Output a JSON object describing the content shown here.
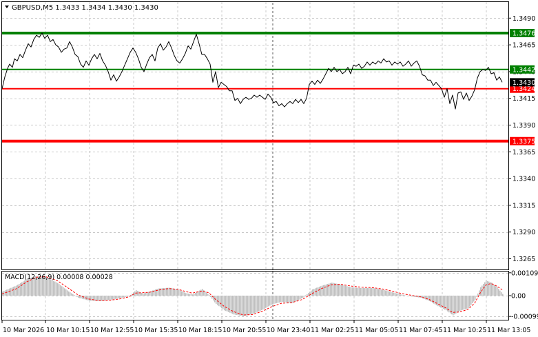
{
  "chart_data": [
    {
      "type": "line",
      "title": "GBPUSD,M5  1.3433 1.3434 1.3430 1.3430",
      "symbol": "GBPUSD,M5",
      "ohlc_label": "1.3433 1.3434 1.3430 1.3430",
      "ylim": [
        1.3255,
        1.3505
      ],
      "yticks": [
        "1.3490",
        "1.3465",
        "1.3440",
        "1.3415",
        "1.3390",
        "1.3365",
        "1.3340",
        "1.3315",
        "1.3290",
        "1.3265"
      ],
      "ytick_values": [
        1.349,
        1.3465,
        1.344,
        1.3415,
        1.339,
        1.3365,
        1.334,
        1.3315,
        1.329,
        1.3265
      ],
      "xlabels": [
        "10 Mar 2026",
        "10 Mar 10:15",
        "10 Mar 12:55",
        "10 Mar 15:35",
        "10 Mar 18:15",
        "10 Mar 20:55",
        "10 Mar 23:40",
        "11 Mar 02:25",
        "11 Mar 05:05",
        "11 Mar 07:45",
        "11 Mar 10:25",
        "11 Mar 13:05"
      ],
      "grid": true,
      "levels": [
        {
          "label": "1.3476",
          "value": 1.3476,
          "color": "#008000",
          "style": "thick"
        },
        {
          "label": "1.3442",
          "value": 1.3442,
          "color": "#008000",
          "style": "thin"
        },
        {
          "label": "1.3424",
          "value": 1.3424,
          "color": "#ff0000",
          "style": "thin"
        },
        {
          "label": "1.3375",
          "value": 1.3375,
          "color": "#ff0000",
          "style": "thick"
        }
      ],
      "current_price": {
        "label": "1.3430",
        "value": 1.343
      },
      "price_series": [
        [
          0,
          1.3424
        ],
        [
          4,
          1.3435
        ],
        [
          8,
          1.3443
        ],
        [
          11,
          1.3447
        ],
        [
          15,
          1.3444
        ],
        [
          18,
          1.3452
        ],
        [
          22,
          1.345
        ],
        [
          26,
          1.3456
        ],
        [
          30,
          1.3453
        ],
        [
          34,
          1.346
        ],
        [
          38,
          1.3466
        ],
        [
          42,
          1.3463
        ],
        [
          46,
          1.347
        ],
        [
          50,
          1.3474
        ],
        [
          54,
          1.3472
        ],
        [
          58,
          1.3476
        ],
        [
          62,
          1.3471
        ],
        [
          66,
          1.3474
        ],
        [
          70,
          1.3468
        ],
        [
          74,
          1.347
        ],
        [
          78,
          1.3465
        ],
        [
          82,
          1.3463
        ],
        [
          86,
          1.3458
        ],
        [
          90,
          1.3461
        ],
        [
          94,
          1.3462
        ],
        [
          98,
          1.3468
        ],
        [
          102,
          1.3463
        ],
        [
          106,
          1.3456
        ],
        [
          110,
          1.3454
        ],
        [
          114,
          1.3447
        ],
        [
          118,
          1.3444
        ],
        [
          122,
          1.345
        ],
        [
          126,
          1.3446
        ],
        [
          130,
          1.3452
        ],
        [
          134,
          1.3456
        ],
        [
          138,
          1.3452
        ],
        [
          142,
          1.3457
        ],
        [
          146,
          1.345
        ],
        [
          150,
          1.3446
        ],
        [
          154,
          1.344
        ],
        [
          158,
          1.3432
        ],
        [
          162,
          1.3437
        ],
        [
          166,
          1.3431
        ],
        [
          170,
          1.3435
        ],
        [
          174,
          1.344
        ],
        [
          178,
          1.3446
        ],
        [
          182,
          1.3452
        ],
        [
          186,
          1.3458
        ],
        [
          190,
          1.3462
        ],
        [
          194,
          1.3458
        ],
        [
          198,
          1.3452
        ],
        [
          202,
          1.3444
        ],
        [
          206,
          1.344
        ],
        [
          210,
          1.3447
        ],
        [
          214,
          1.3453
        ],
        [
          218,
          1.3456
        ],
        [
          222,
          1.345
        ],
        [
          226,
          1.3462
        ],
        [
          230,
          1.3466
        ],
        [
          234,
          1.346
        ],
        [
          238,
          1.3463
        ],
        [
          242,
          1.3468
        ],
        [
          246,
          1.3462
        ],
        [
          250,
          1.3455
        ],
        [
          254,
          1.345
        ],
        [
          258,
          1.3448
        ],
        [
          262,
          1.3452
        ],
        [
          266,
          1.3457
        ],
        [
          270,
          1.3464
        ],
        [
          274,
          1.3461
        ],
        [
          278,
          1.3468
        ],
        [
          282,
          1.3475
        ],
        [
          286,
          1.3466
        ],
        [
          290,
          1.3456
        ],
        [
          294,
          1.3456
        ],
        [
          298,
          1.3452
        ],
        [
          302,
          1.3447
        ],
        [
          306,
          1.343
        ],
        [
          310,
          1.344
        ],
        [
          314,
          1.3425
        ],
        [
          318,
          1.343
        ],
        [
          322,
          1.3428
        ],
        [
          326,
          1.3426
        ],
        [
          330,
          1.3422
        ],
        [
          334,
          1.3422
        ],
        [
          338,
          1.3413
        ],
        [
          342,
          1.3415
        ],
        [
          346,
          1.341
        ],
        [
          350,
          1.3414
        ],
        [
          354,
          1.3416
        ],
        [
          358,
          1.3414
        ],
        [
          362,
          1.3415
        ],
        [
          366,
          1.3418
        ],
        [
          370,
          1.3416
        ],
        [
          374,
          1.3418
        ],
        [
          378,
          1.3416
        ],
        [
          382,
          1.3414
        ],
        [
          386,
          1.3419
        ],
        [
          390,
          1.3416
        ],
        [
          394,
          1.3411
        ],
        [
          398,
          1.3412
        ],
        [
          402,
          1.3408
        ],
        [
          406,
          1.341
        ],
        [
          410,
          1.3407
        ],
        [
          414,
          1.341
        ],
        [
          418,
          1.3412
        ],
        [
          422,
          1.341
        ],
        [
          426,
          1.3414
        ],
        [
          430,
          1.3411
        ],
        [
          434,
          1.3414
        ],
        [
          438,
          1.341
        ],
        [
          442,
          1.3415
        ],
        [
          446,
          1.3428
        ],
        [
          450,
          1.3431
        ],
        [
          454,
          1.3428
        ],
        [
          458,
          1.3432
        ],
        [
          462,
          1.3429
        ],
        [
          466,
          1.3433
        ],
        [
          470,
          1.3438
        ],
        [
          474,
          1.3443
        ],
        [
          478,
          1.344
        ],
        [
          482,
          1.3444
        ],
        [
          486,
          1.344
        ],
        [
          490,
          1.3442
        ],
        [
          494,
          1.3438
        ],
        [
          498,
          1.344
        ],
        [
          502,
          1.3444
        ],
        [
          506,
          1.3438
        ],
        [
          510,
          1.3446
        ],
        [
          514,
          1.3445
        ],
        [
          518,
          1.3447
        ],
        [
          522,
          1.3443
        ],
        [
          526,
          1.3445
        ],
        [
          530,
          1.3449
        ],
        [
          534,
          1.3446
        ],
        [
          538,
          1.3449
        ],
        [
          542,
          1.3447
        ],
        [
          546,
          1.345
        ],
        [
          550,
          1.3448
        ],
        [
          554,
          1.3452
        ],
        [
          558,
          1.3449
        ],
        [
          562,
          1.345
        ],
        [
          566,
          1.3446
        ],
        [
          570,
          1.3449
        ],
        [
          574,
          1.3447
        ],
        [
          578,
          1.3449
        ],
        [
          582,
          1.3445
        ],
        [
          586,
          1.3447
        ],
        [
          590,
          1.345
        ],
        [
          594,
          1.3445
        ],
        [
          598,
          1.3448
        ],
        [
          602,
          1.345
        ],
        [
          606,
          1.3445
        ],
        [
          610,
          1.3437
        ],
        [
          614,
          1.3436
        ],
        [
          618,
          1.3432
        ],
        [
          622,
          1.3432
        ],
        [
          626,
          1.3427
        ],
        [
          630,
          1.343
        ],
        [
          634,
          1.3427
        ],
        [
          638,
          1.3424
        ],
        [
          642,
          1.3416
        ],
        [
          646,
          1.3424
        ],
        [
          650,
          1.341
        ],
        [
          654,
          1.3418
        ],
        [
          658,
          1.3405
        ],
        [
          662,
          1.342
        ],
        [
          666,
          1.3421
        ],
        [
          670,
          1.3414
        ],
        [
          674,
          1.342
        ],
        [
          678,
          1.3413
        ],
        [
          682,
          1.3417
        ],
        [
          686,
          1.3423
        ],
        [
          690,
          1.3434
        ],
        [
          694,
          1.344
        ],
        [
          698,
          1.3442
        ],
        [
          702,
          1.3441
        ],
        [
          706,
          1.3444
        ],
        [
          710,
          1.3438
        ],
        [
          714,
          1.3439
        ],
        [
          718,
          1.3432
        ],
        [
          722,
          1.3435
        ],
        [
          726,
          1.343
        ]
      ]
    },
    {
      "type": "area",
      "title": "MACD(12,26,9) 0.00008 0.00028",
      "indicator_label": "MACD(12,26,9) 0.00008 0.00028",
      "ylim": [
        -0.00115,
        0.00115
      ],
      "yticks": [
        "0.00109",
        "0.00",
        "-0.00099"
      ],
      "ytick_values": [
        0.00109,
        0.0,
        -0.00099
      ],
      "histogram_color": "#c0c0c0",
      "signal_color": "#ff0000",
      "histogram": [
        [
          0,
          0.0002
        ],
        [
          20,
          0.00048
        ],
        [
          36,
          0.0008
        ],
        [
          50,
          0.00094
        ],
        [
          64,
          0.00088
        ],
        [
          80,
          0.0006
        ],
        [
          96,
          0.0002
        ],
        [
          110,
          -0.0001
        ],
        [
          126,
          -0.00024
        ],
        [
          142,
          -0.00026
        ],
        [
          156,
          -0.0002
        ],
        [
          170,
          -0.00012
        ],
        [
          184,
          -2e-05
        ],
        [
          194,
          0.00026
        ],
        [
          204,
          0.0001
        ],
        [
          214,
          0.0002
        ],
        [
          226,
          0.00034
        ],
        [
          242,
          0.00038
        ],
        [
          256,
          0.00028
        ],
        [
          266,
          0.00012
        ],
        [
          276,
          6e-05
        ],
        [
          290,
          0.00032
        ],
        [
          300,
          2e-05
        ],
        [
          310,
          -0.0004
        ],
        [
          322,
          -0.0007
        ],
        [
          336,
          -0.0009
        ],
        [
          350,
          -0.00098
        ],
        [
          364,
          -0.00086
        ],
        [
          378,
          -0.00066
        ],
        [
          392,
          -0.0004
        ],
        [
          406,
          -0.0003
        ],
        [
          420,
          -0.00036
        ],
        [
          436,
          -0.0001
        ],
        [
          450,
          0.0003
        ],
        [
          464,
          0.00048
        ],
        [
          478,
          0.00062
        ],
        [
          492,
          0.00052
        ],
        [
          506,
          0.0004
        ],
        [
          522,
          0.00036
        ],
        [
          538,
          0.00036
        ],
        [
          552,
          0.00028
        ],
        [
          566,
          0.00016
        ],
        [
          580,
          4e-05
        ],
        [
          594,
          -4e-05
        ],
        [
          608,
          -0.0001
        ],
        [
          620,
          -0.00026
        ],
        [
          632,
          -0.0005
        ],
        [
          644,
          -0.0007
        ],
        [
          654,
          -0.00094
        ],
        [
          664,
          -0.00072
        ],
        [
          676,
          -0.0006
        ],
        [
          686,
          -0.0002
        ],
        [
          694,
          0.0004
        ],
        [
          702,
          0.00072
        ],
        [
          710,
          0.00062
        ],
        [
          718,
          0.0004
        ],
        [
          726,
          8e-05
        ]
      ],
      "signal": [
        [
          0,
          8e-05
        ],
        [
          20,
          0.00032
        ],
        [
          36,
          0.00066
        ],
        [
          50,
          0.00088
        ],
        [
          64,
          0.0009
        ],
        [
          80,
          0.00072
        ],
        [
          96,
          0.00036
        ],
        [
          110,
          4e-05
        ],
        [
          126,
          -0.00016
        ],
        [
          142,
          -0.00024
        ],
        [
          156,
          -0.00022
        ],
        [
          170,
          -0.00016
        ],
        [
          184,
          -6e-05
        ],
        [
          194,
          0.00012
        ],
        [
          204,
          0.00014
        ],
        [
          214,
          0.00016
        ],
        [
          226,
          0.00026
        ],
        [
          242,
          0.00034
        ],
        [
          256,
          0.0003
        ],
        [
          266,
          0.0002
        ],
        [
          276,
          0.00012
        ],
        [
          290,
          0.00022
        ],
        [
          300,
          0.00014
        ],
        [
          310,
          -0.00018
        ],
        [
          322,
          -0.0005
        ],
        [
          336,
          -0.00076
        ],
        [
          350,
          -0.00092
        ],
        [
          364,
          -0.0009
        ],
        [
          378,
          -0.00074
        ],
        [
          392,
          -0.00052
        ],
        [
          406,
          -0.00036
        ],
        [
          420,
          -0.00034
        ],
        [
          436,
          -0.00018
        ],
        [
          450,
          0.0001
        ],
        [
          464,
          0.00034
        ],
        [
          478,
          0.00052
        ],
        [
          492,
          0.00054
        ],
        [
          506,
          0.00046
        ],
        [
          522,
          0.0004
        ],
        [
          538,
          0.00038
        ],
        [
          552,
          0.00032
        ],
        [
          566,
          0.00022
        ],
        [
          580,
          0.0001
        ],
        [
          594,
          2e-05
        ],
        [
          608,
          -6e-05
        ],
        [
          620,
          -0.00018
        ],
        [
          632,
          -0.00038
        ],
        [
          644,
          -0.00058
        ],
        [
          654,
          -0.0008
        ],
        [
          664,
          -0.00078
        ],
        [
          676,
          -0.00066
        ],
        [
          686,
          -0.00036
        ],
        [
          694,
          0.00012
        ],
        [
          702,
          0.0005
        ],
        [
          710,
          0.00058
        ],
        [
          718,
          0.00046
        ],
        [
          726,
          0.00028
        ]
      ]
    }
  ]
}
